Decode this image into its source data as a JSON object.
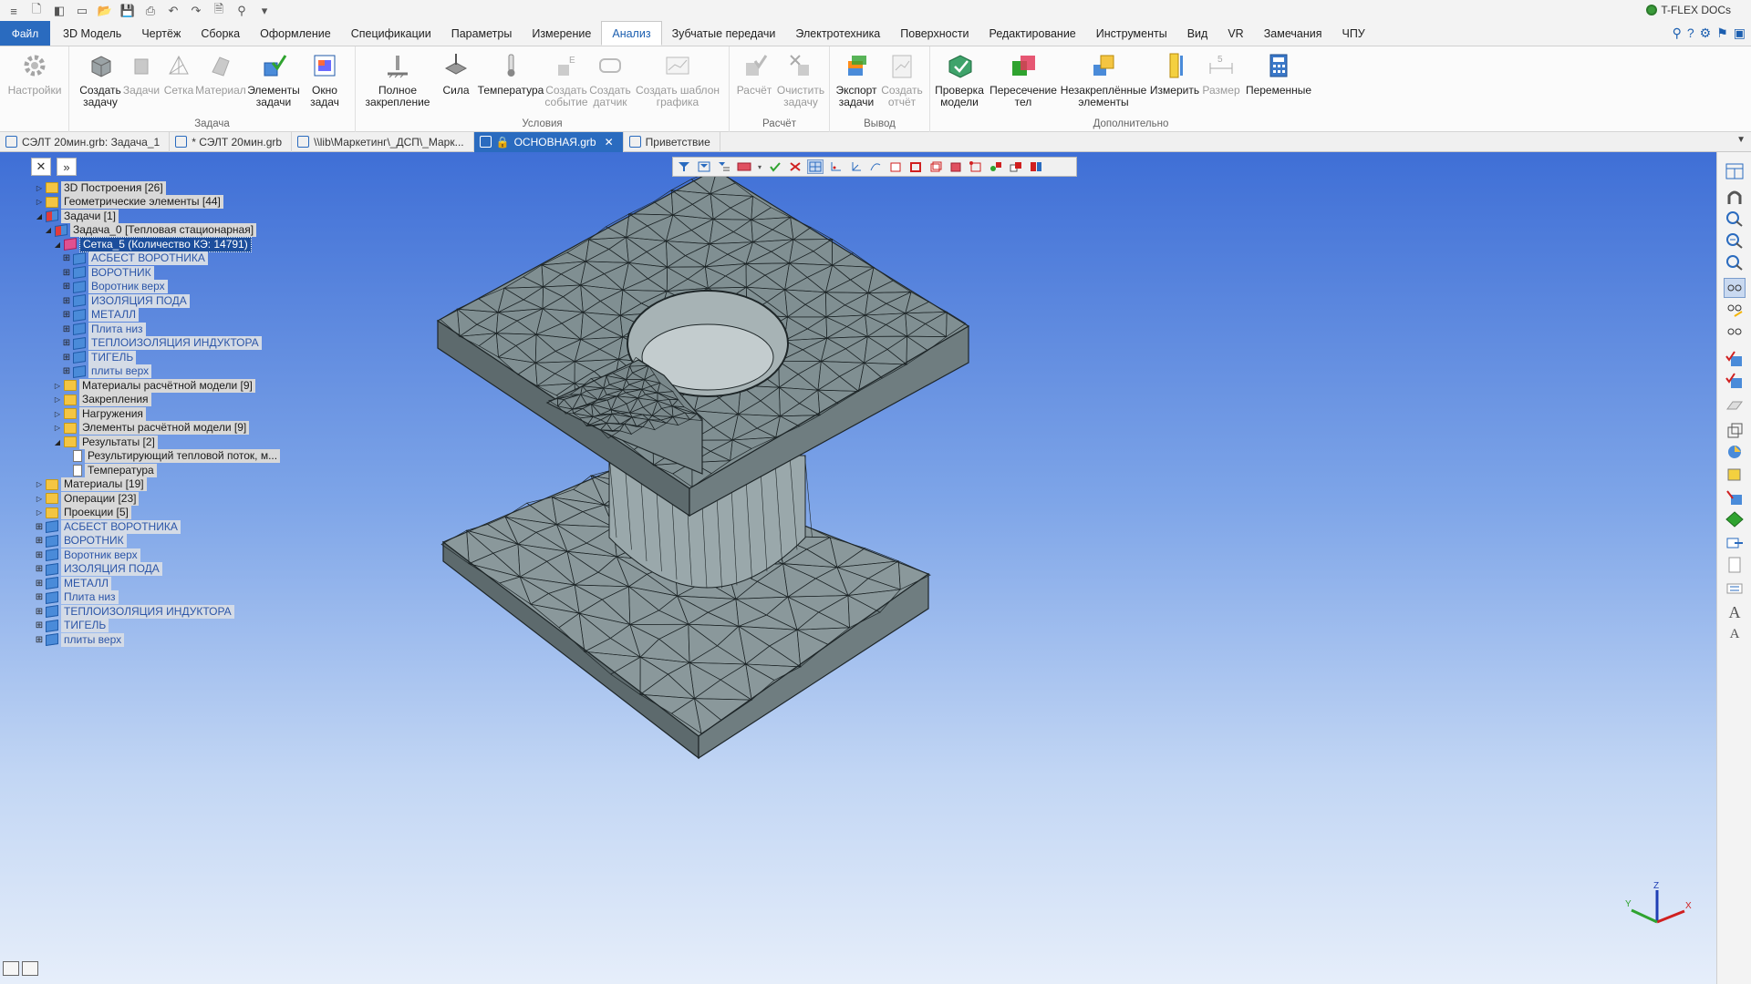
{
  "quick_access": {
    "icons": [
      "menu-icon",
      "new-file-icon",
      "cube-icon",
      "window-icon",
      "open-folder-icon",
      "save-icon",
      "print-icon",
      "undo-icon",
      "redo-icon",
      "doc-icon",
      "binoculars-icon",
      "customize-icon"
    ],
    "brand": "T-FLEX DOCs"
  },
  "menubar": {
    "file": "Файл",
    "items": [
      "3D Модель",
      "Чертёж",
      "Сборка",
      "Оформление",
      "Спецификации",
      "Параметры",
      "Измерение",
      "Анализ",
      "Зубчатые передачи",
      "Электротехника",
      "Поверхности",
      "Редактирование",
      "Инструменты",
      "Вид",
      "VR",
      "Замечания",
      "ЧПУ"
    ],
    "active": "Анализ"
  },
  "ribbon": {
    "groups": [
      {
        "label": "",
        "tools": [
          {
            "label": "Настройки",
            "icon": "settings-gear-icon",
            "disabled": true
          }
        ]
      },
      {
        "label": "Задача",
        "tools": [
          {
            "label": "Создать\nзадачу",
            "icon": "create-task-icon",
            "disabled": false
          },
          {
            "label": "Задачи",
            "icon": "tasks-icon",
            "disabled": true
          },
          {
            "label": "Сетка",
            "icon": "mesh-icon",
            "disabled": true
          },
          {
            "label": "Материал",
            "icon": "material-icon",
            "disabled": true
          },
          {
            "label": "Элементы\nзадачи",
            "icon": "task-elements-icon",
            "disabled": false
          },
          {
            "label": "Окно\nзадач",
            "icon": "task-window-icon",
            "disabled": false
          }
        ]
      },
      {
        "label": "Условия",
        "tools": [
          {
            "label": "Полное\nзакрепление",
            "icon": "full-fixation-icon",
            "disabled": false
          },
          {
            "label": "Сила",
            "icon": "force-icon",
            "disabled": false
          },
          {
            "label": "Температура",
            "icon": "temperature-icon",
            "disabled": false
          },
          {
            "label": "Создать\nсобытие",
            "icon": "create-event-icon",
            "disabled": true
          },
          {
            "label": "Создать\nдатчик",
            "icon": "create-sensor-icon",
            "disabled": true
          },
          {
            "label": "Создать шаблон\nграфика",
            "icon": "graph-template-icon",
            "disabled": true
          }
        ]
      },
      {
        "label": "Расчёт",
        "tools": [
          {
            "label": "Расчёт",
            "icon": "calculate-icon",
            "disabled": true
          },
          {
            "label": "Очистить\nзадачу",
            "icon": "clear-task-icon",
            "disabled": true
          }
        ]
      },
      {
        "label": "Вывод",
        "tools": [
          {
            "label": "Экспорт\nзадачи",
            "icon": "export-task-icon",
            "disabled": false
          },
          {
            "label": "Создать\nотчёт",
            "icon": "create-report-icon",
            "disabled": true
          }
        ]
      },
      {
        "label": "Дополнительно",
        "tools": [
          {
            "label": "Проверка\nмодели",
            "icon": "model-check-icon",
            "disabled": false
          },
          {
            "label": "Пересечение\nтел",
            "icon": "body-intersection-icon",
            "disabled": false
          },
          {
            "label": "Незакреплённые\nэлементы",
            "icon": "unfixed-elements-icon",
            "disabled": false
          },
          {
            "label": "Измерить",
            "icon": "measure-icon",
            "disabled": false
          },
          {
            "label": "Размер",
            "icon": "dimension-icon",
            "disabled": true
          },
          {
            "label": "Переменные",
            "icon": "variables-icon",
            "disabled": false
          }
        ]
      }
    ]
  },
  "doc_tabs": [
    {
      "label": "СЭЛТ 20мин.grb: Задача_1",
      "active": false
    },
    {
      "label": "* СЭЛТ 20мин.grb",
      "active": false
    },
    {
      "label": "\\\\lib\\Маркетинг\\_ДСП\\_Марк...",
      "active": false
    },
    {
      "label": "ОСНОВНАЯ.grb",
      "active": true
    },
    {
      "label": "Приветствие",
      "active": false
    }
  ],
  "tree": {
    "items": [
      {
        "label": "3D Построения [26]",
        "level": 0,
        "icon": "folder",
        "expander": "closed"
      },
      {
        "label": "Геометрические элементы [44]",
        "level": 0,
        "icon": "folder",
        "expander": "closed"
      },
      {
        "label": "Задачи [1]",
        "level": 0,
        "icon": "task",
        "expander": "open"
      },
      {
        "label": "Задача_0 [Тепловая стационарная]",
        "level": 1,
        "icon": "task",
        "expander": "open"
      },
      {
        "label": "Сетка_5 (Количество КЭ: 14791)",
        "level": 2,
        "icon": "mesh",
        "expander": "open",
        "selected": true
      },
      {
        "label": "АСБЕСТ ВОРОТНИКА",
        "level": 3,
        "icon": "body",
        "expander": "plus",
        "blue": true
      },
      {
        "label": "ВОРОТНИК",
        "level": 3,
        "icon": "body",
        "expander": "plus",
        "blue": true
      },
      {
        "label": "Воротник верх",
        "level": 3,
        "icon": "body",
        "expander": "plus",
        "blue": true
      },
      {
        "label": "ИЗОЛЯЦИЯ ПОДА",
        "level": 3,
        "icon": "body",
        "expander": "plus",
        "blue": true
      },
      {
        "label": "МЕТАЛЛ",
        "level": 3,
        "icon": "body",
        "expander": "plus",
        "blue": true
      },
      {
        "label": "Плита низ",
        "level": 3,
        "icon": "body",
        "expander": "plus",
        "blue": true
      },
      {
        "label": "ТЕПЛОИЗОЛЯЦИЯ ИНДУКТОРА",
        "level": 3,
        "icon": "body",
        "expander": "plus",
        "blue": true
      },
      {
        "label": "ТИГЕЛЬ",
        "level": 3,
        "icon": "body",
        "expander": "plus",
        "blue": true
      },
      {
        "label": "плиты верх",
        "level": 3,
        "icon": "body",
        "expander": "plus",
        "blue": true
      },
      {
        "label": "Материалы расчётной модели [9]",
        "level": 2,
        "icon": "folder",
        "expander": "closed"
      },
      {
        "label": "Закрепления",
        "level": 2,
        "icon": "folder",
        "expander": "closed"
      },
      {
        "label": "Нагружения",
        "level": 2,
        "icon": "folder",
        "expander": "closed"
      },
      {
        "label": "Элементы расчётной модели [9]",
        "level": 2,
        "icon": "folder",
        "expander": "closed"
      },
      {
        "label": "Результаты [2]",
        "level": 2,
        "icon": "folder",
        "expander": "open"
      },
      {
        "label": "Результирующий тепловой поток, м...",
        "level": 3,
        "icon": "doc",
        "expander": "none"
      },
      {
        "label": "Температура",
        "level": 3,
        "icon": "doc",
        "expander": "none"
      },
      {
        "label": "Материалы [19]",
        "level": 0,
        "icon": "folder",
        "expander": "closed"
      },
      {
        "label": "Операции [23]",
        "level": 0,
        "icon": "folder",
        "expander": "closed"
      },
      {
        "label": "Проекции [5]",
        "level": 0,
        "icon": "folder",
        "expander": "closed"
      },
      {
        "label": "АСБЕСТ ВОРОТНИКА",
        "level": 0,
        "icon": "body",
        "expander": "plus",
        "blue": true
      },
      {
        "label": "ВОРОТНИК",
        "level": 0,
        "icon": "body",
        "expander": "plus",
        "blue": true
      },
      {
        "label": "Воротник верх",
        "level": 0,
        "icon": "body",
        "expander": "plus",
        "blue": true
      },
      {
        "label": "ИЗОЛЯЦИЯ ПОДА",
        "level": 0,
        "icon": "body",
        "expander": "plus",
        "blue": true
      },
      {
        "label": "МЕТАЛЛ",
        "level": 0,
        "icon": "body",
        "expander": "plus",
        "blue": true
      },
      {
        "label": "Плита низ",
        "level": 0,
        "icon": "body",
        "expander": "plus",
        "blue": true
      },
      {
        "label": "ТЕПЛОИЗОЛЯЦИЯ ИНДУКТОРА",
        "level": 0,
        "icon": "body",
        "expander": "plus",
        "blue": true
      },
      {
        "label": "ТИГЕЛЬ",
        "level": 0,
        "icon": "body",
        "expander": "plus",
        "blue": true
      },
      {
        "label": "плиты верх",
        "level": 0,
        "icon": "body",
        "expander": "plus",
        "blue": true
      }
    ]
  },
  "triad": {
    "x": "X",
    "y": "Y",
    "z": "Z"
  },
  "colors": {
    "accent": "#2a6bbf",
    "mesh_face": "#7b8a8d",
    "mesh_edge": "#1e2628",
    "viewport_top": "#3f6fd6",
    "viewport_bottom": "#e6eefa"
  }
}
